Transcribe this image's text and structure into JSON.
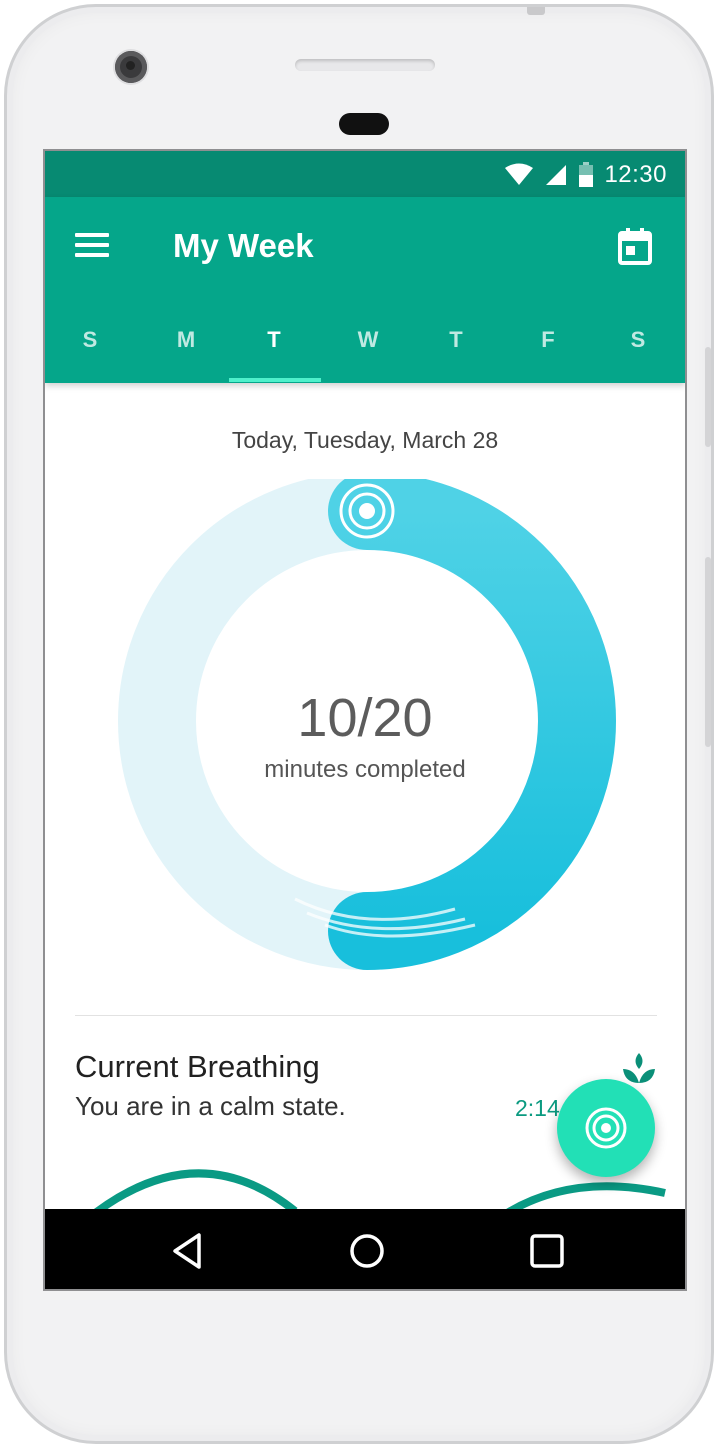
{
  "status_bar": {
    "time": "12:30",
    "icons": [
      "wifi-icon",
      "cell-signal-icon",
      "battery-icon"
    ]
  },
  "app_bar": {
    "title": "My Week",
    "menu_icon": "menu-icon",
    "calendar_icon": "calendar-icon"
  },
  "week_days": [
    {
      "label": "S",
      "active": false
    },
    {
      "label": "M",
      "active": false
    },
    {
      "label": "T",
      "active": true
    },
    {
      "label": "W",
      "active": false
    },
    {
      "label": "T",
      "active": false
    },
    {
      "label": "F",
      "active": false
    },
    {
      "label": "S",
      "active": false
    }
  ],
  "summary": {
    "date_label": "Today, Tuesday, March 28",
    "progress_text": "10/20",
    "progress_caption": "minutes completed",
    "progress_fraction": 0.5
  },
  "card": {
    "title": "Current Breathing",
    "subtitle": "You are in a calm state.",
    "time_value": "2:14",
    "icon": "leaf-icon"
  },
  "fab": {
    "icon": "breathe-target-icon"
  },
  "nav_bar": {
    "icons": [
      "back-icon",
      "home-icon",
      "recents-icon"
    ]
  },
  "colors": {
    "status_bar": "#078a72",
    "app_bar": "#05a68a",
    "tab_indicator": "#4ff0cb",
    "ring_progress": "#2cc7df",
    "ring_track": "#e2f4f9",
    "fab": "#22e0b6",
    "accent_text": "#0a9a80"
  }
}
